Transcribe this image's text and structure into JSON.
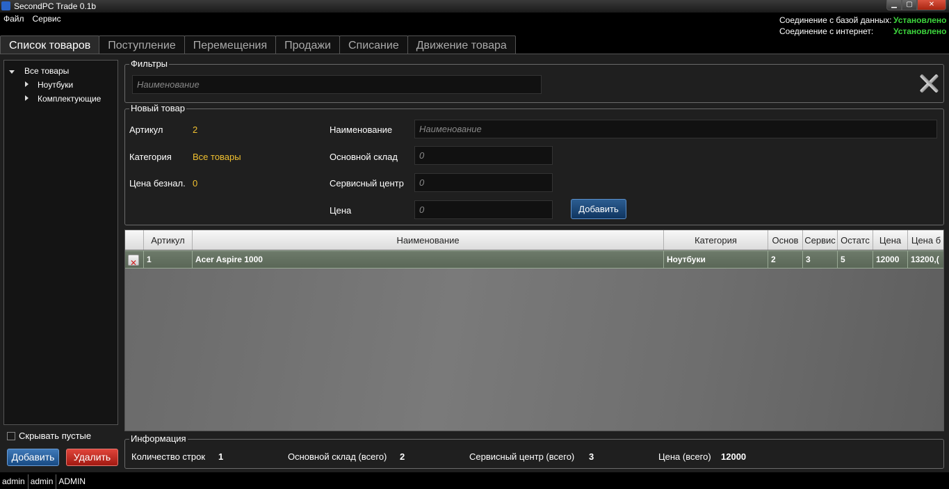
{
  "window": {
    "title": "SecondPC Trade 0.1b"
  },
  "menu": [
    "Файл",
    "Сервис"
  ],
  "connection": {
    "db_label": "Соединение с базой данных:",
    "db_value": "Установлено",
    "net_label": "Соединение с интернет:",
    "net_value": "Установлено",
    "ok_color": "#3dd63d"
  },
  "tabs": [
    {
      "label": "Список товаров",
      "active": true
    },
    {
      "label": "Поступление"
    },
    {
      "label": "Перемещения"
    },
    {
      "label": "Продажи"
    },
    {
      "label": "Списание"
    },
    {
      "label": "Движение товара"
    }
  ],
  "tree": {
    "root": "Все товары",
    "children": [
      "Ноутбуки",
      "Комплектующие"
    ]
  },
  "left_panel": {
    "hide_empty_label": "Скрывать пустые",
    "hide_empty_checked": false,
    "add_label": "Добавить",
    "delete_label": "Удалить"
  },
  "filters": {
    "title": "Фильтры",
    "name_placeholder": "Наименование"
  },
  "new_item": {
    "title": "Новый товар",
    "article_label": "Артикул",
    "article_value": "2",
    "category_label": "Категория",
    "category_value": "Все товары",
    "cashless_label": "Цена безнал.",
    "cashless_value": "0",
    "name_label": "Наименование",
    "name_placeholder": "Наименование",
    "main_stock_label": "Основной склад",
    "main_stock_placeholder": "0",
    "service_label": "Сервисный центр",
    "service_placeholder": "0",
    "price_label": "Цена",
    "price_placeholder": "0",
    "add_label": "Добавить"
  },
  "table": {
    "columns": [
      "",
      "Артикул",
      "Наименование",
      "Категория",
      "Основ",
      "Сервис",
      "Остатс",
      "Цена",
      "Цена б"
    ],
    "rows": [
      [
        "",
        "1",
        "Acer Aspire 1000",
        "Ноутбуки",
        "2",
        "3",
        "5",
        "12000",
        "13200,("
      ]
    ]
  },
  "info": {
    "title": "Информация",
    "rows_label": "Количество строк",
    "rows_value": "1",
    "main_label": "Основной склад (всего)",
    "main_value": "2",
    "service_label": "Сервисный центр (всего)",
    "service_value": "3",
    "price_label": "Цена (всего)",
    "price_value": "12000"
  },
  "statusbar": [
    "admin",
    "admin",
    "ADMIN"
  ]
}
